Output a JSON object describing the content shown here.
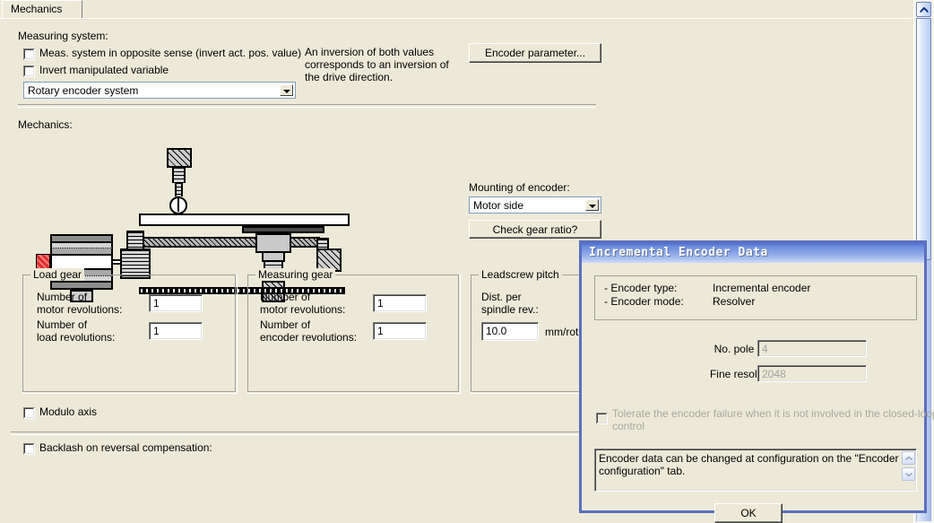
{
  "window": {
    "tab_label": "Mechanics"
  },
  "measuring_system": {
    "section_label": "Measuring system:",
    "checkbox_invert_sense": "Meas. system in opposite sense (invert act. pos. value)",
    "checkbox_invert_manipulated": "Invert manipulated variable",
    "encoder_system_value": "Rotary encoder system",
    "note_text": "An inversion of both values corresponds to an inversion of the drive direction.",
    "encoder_parameter_button": "Encoder parameter..."
  },
  "mechanics": {
    "section_label": "Mechanics:",
    "mounting_label": "Mounting of encoder:",
    "mounting_value": "Motor side",
    "check_gear_ratio_button": "Check gear ratio?"
  },
  "load_gear": {
    "title": "Load gear",
    "motor_rev_label_l1": "Number of",
    "motor_rev_label_l2": "motor revolutions:",
    "motor_rev_value": "1",
    "load_rev_label_l1": "Number of",
    "load_rev_label_l2": "load revolutions:",
    "load_rev_value": "1"
  },
  "measuring_gear": {
    "title": "Measuring gear",
    "motor_rev_label_l1": "Number of",
    "motor_rev_label_l2": "motor revolutions:",
    "motor_rev_value": "1",
    "encoder_rev_label_l1": "Number of",
    "encoder_rev_label_l2": "encoder revolutions:",
    "encoder_rev_value": "1"
  },
  "leadscrew_pitch": {
    "title": "Leadscrew pitch",
    "dist_label_l1": "Dist. per",
    "dist_label_l2": "spindle rev.:",
    "value": "10.0",
    "unit": "mm/rot"
  },
  "options": {
    "modulo_axis": "Modulo axis",
    "backlash": "Backlash on reversal compensation:"
  },
  "dialog": {
    "title": "Incremental Encoder Data",
    "encoder_type_label": "- Encoder type:",
    "encoder_type_value": "Incremental encoder",
    "encoder_mode_label": "- Encoder mode:",
    "encoder_mode_value": "Resolver",
    "pole_pairs_label": "No. pole pairs:",
    "pole_pairs_value": "4",
    "fine_resolution_label": "Fine resolution:",
    "fine_resolution_value": "2048",
    "tolerate_checkbox_l1": "Tolerate the encoder failure when it is not involved in the closed-loop",
    "tolerate_checkbox_l2": "control",
    "message_l1": "Encoder data can be changed at configuration on the \"Encoder",
    "message_l2": "configuration\" tab.",
    "ok_button": "OK",
    "scroll_up_icon": "chevron-up-icon",
    "scroll_down_icon": "chevron-down-icon"
  },
  "scrollbar": {
    "up_icon": "chevron-up-icon",
    "down_icon": "chevron-down-icon"
  },
  "colors": {
    "face": "#ece9d8",
    "dialog_border": "#5a6fbf",
    "title_blue": "#4f6fd0",
    "field_border": "#7f9db9",
    "accent_red": "#e02b2b"
  }
}
